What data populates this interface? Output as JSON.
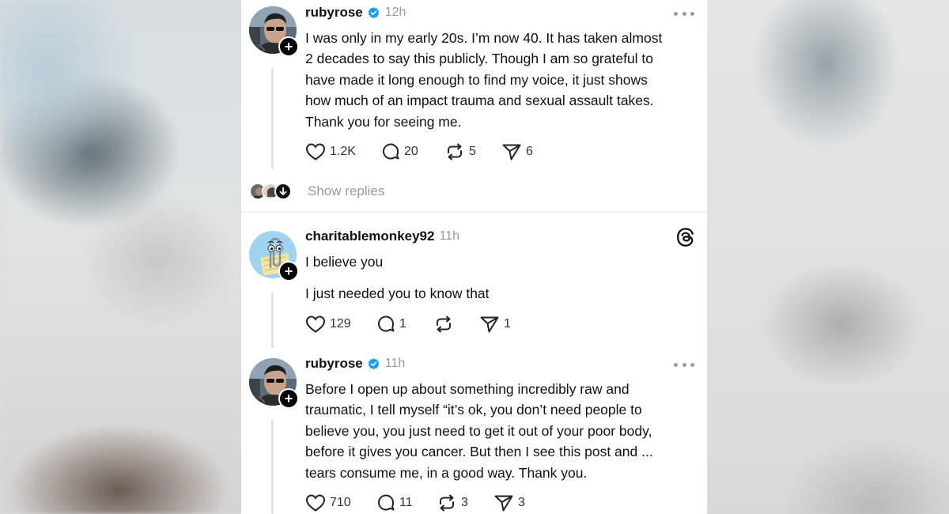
{
  "posts": [
    {
      "username": "rubyrose",
      "verified": true,
      "time": "12h",
      "avatar": "person-avatar",
      "body": [
        "I was only in my early 20s. I’m now 40. It has taken almost",
        "2 decades to say this publicly. Though I am so grateful to",
        "have made it long enough to find my voice, it just shows",
        "how much of an impact trauma and sexual assault takes.",
        "Thank you for seeing me."
      ],
      "likes": "1.2K",
      "replies": "20",
      "reposts": "5",
      "shares": "6"
    },
    {
      "username": "charitablemonkey92",
      "verified": false,
      "time": "11h",
      "avatar": "paperclip-avatar",
      "body": [
        "I believe you",
        "I just needed you to know that"
      ],
      "likes": "129",
      "replies": "1",
      "reposts": "",
      "shares": "1"
    },
    {
      "username": "rubyrose",
      "verified": true,
      "time": "11h",
      "avatar": "person-avatar",
      "body": [
        "Before I open up about something incredibly raw and",
        "traumatic, I tell myself “it’s ok, you don’t need people to",
        "believe you, you just need to get it out of your poor body,",
        "before it gives you cancer. But then I see this post and ...",
        "tears consume me, in a good way. Thank you."
      ],
      "likes": "710",
      "replies": "11",
      "reposts": "3",
      "shares": "3"
    }
  ],
  "show_replies": "Show replies",
  "colors": {
    "verified": "#1d9bf0",
    "secondary_text": "#9a9a9a",
    "primary_text": "#111111",
    "thread_line": "#e3e3e3"
  },
  "icons": {
    "like": "heart-icon",
    "reply": "speech-bubble-icon",
    "repost": "repost-arrows-icon",
    "share": "paper-plane-icon",
    "more": "more-dots-icon",
    "brand": "threads-logo-icon"
  }
}
